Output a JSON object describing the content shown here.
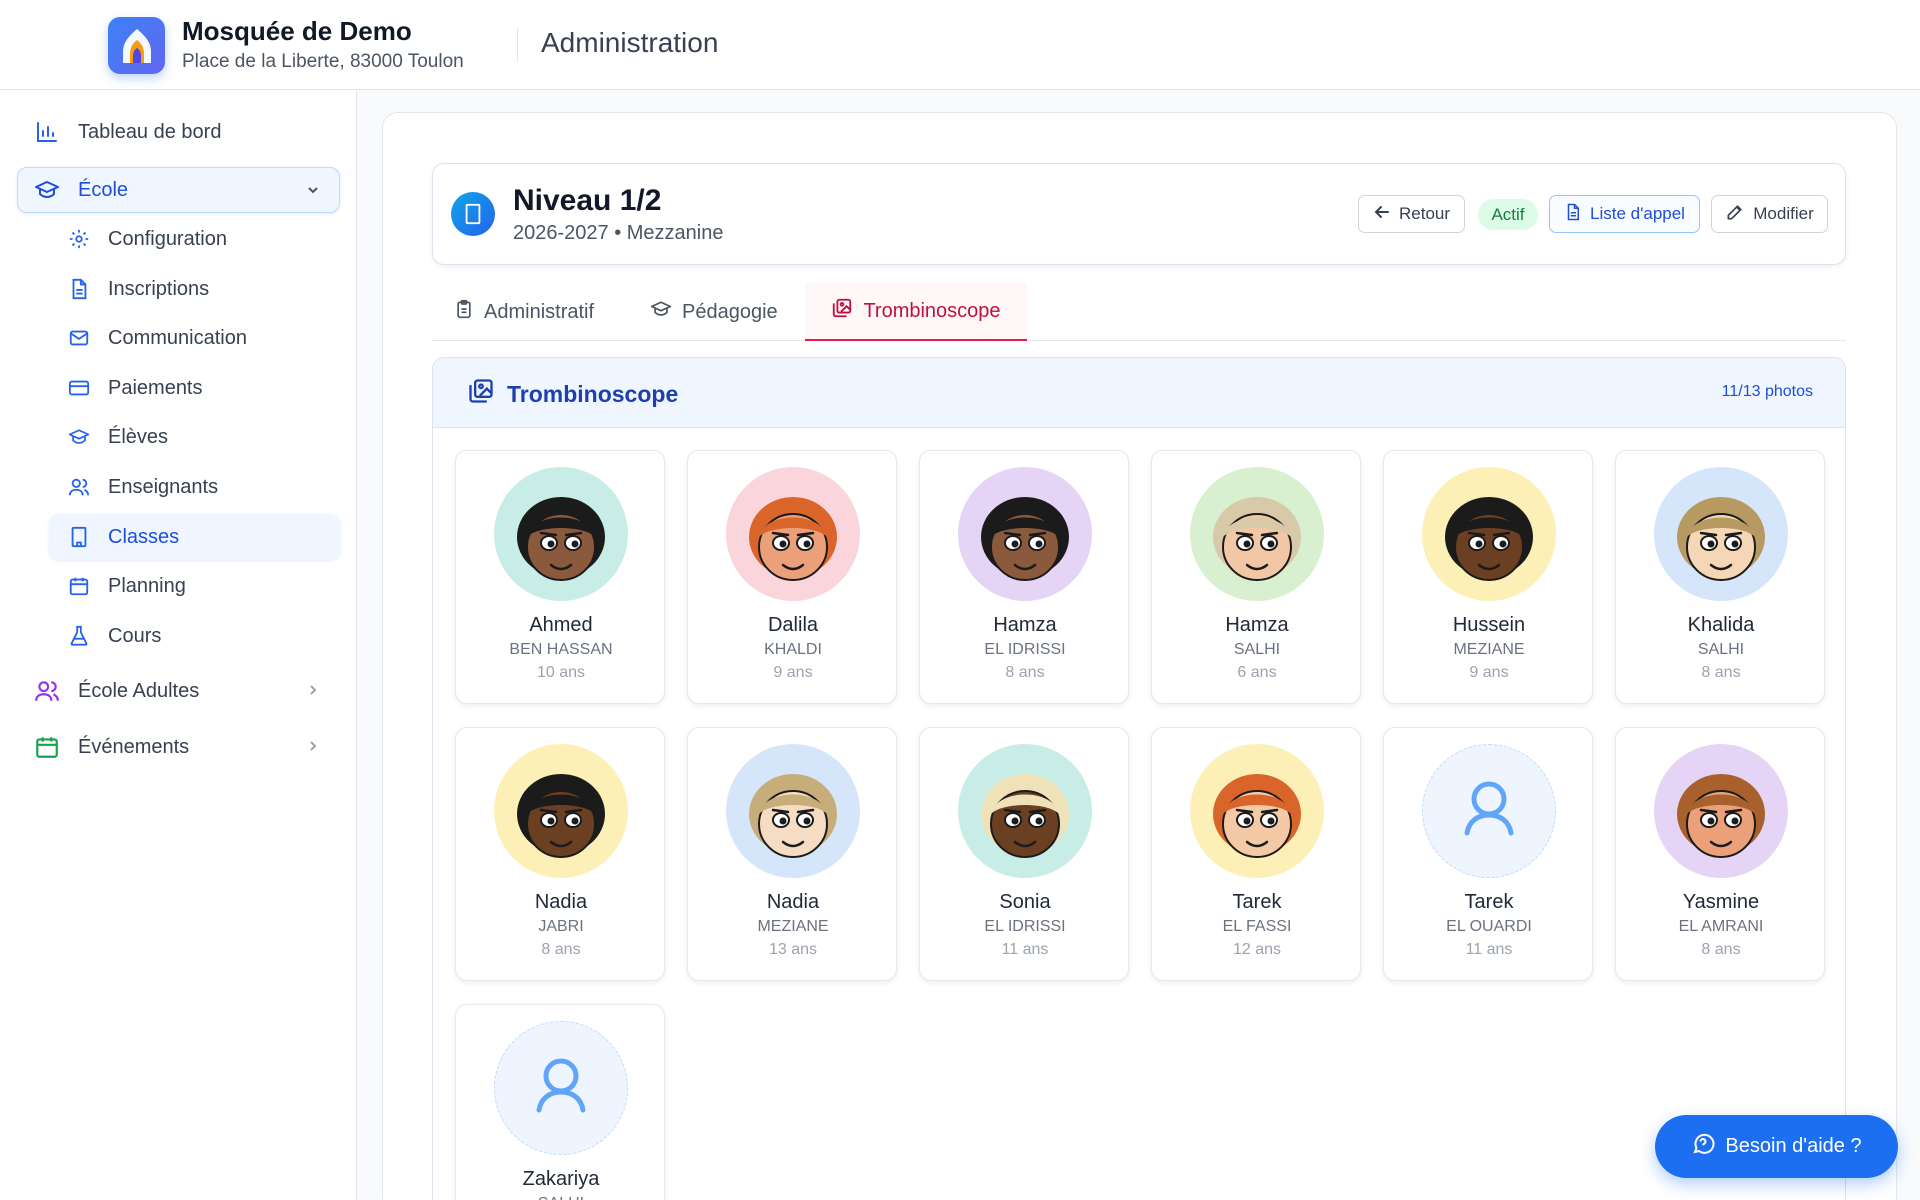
{
  "header": {
    "org_name": "Mosquée de Demo",
    "org_address": "Place de la Liberte, 83000 Toulon",
    "section": "Administration"
  },
  "sidebar": {
    "dashboard": "Tableau de bord",
    "ecole": "École",
    "sub": {
      "configuration": "Configuration",
      "inscriptions": "Inscriptions",
      "communication": "Communication",
      "paiements": "Paiements",
      "eleves": "Élèves",
      "enseignants": "Enseignants",
      "classes": "Classes",
      "planning": "Planning",
      "cours": "Cours"
    },
    "ecole_adultes": "École Adultes",
    "evenements": "Événements"
  },
  "class_header": {
    "title": "Niveau 1/2",
    "subtitle": "2026-2027 • Mezzanine",
    "retour": "Retour",
    "status": "Actif",
    "liste_appel": "Liste d'appel",
    "modifier": "Modifier"
  },
  "tabs": {
    "administratif": "Administratif",
    "pedagogie": "Pédagogie",
    "trombinoscope": "Trombinoscope"
  },
  "trombi": {
    "title": "Trombinoscope",
    "count": "11/13 photos",
    "students": [
      {
        "first": "Ahmed",
        "last": "BEN HASSAN",
        "age": "10 ans",
        "bg": "#c7ede6",
        "skin": "#8b5a3c",
        "hair": "#1b1b1b"
      },
      {
        "first": "Dalila",
        "last": "KHALDI",
        "age": "9 ans",
        "bg": "#fbd5dc",
        "skin": "#eba07a",
        "hair": "#d9652b"
      },
      {
        "first": "Hamza",
        "last": "EL IDRISSI",
        "age": "8 ans",
        "bg": "#e5d4f6",
        "skin": "#8b5a3c",
        "hair": "#1b1b1b"
      },
      {
        "first": "Hamza",
        "last": "SALHI",
        "age": "6 ans",
        "bg": "#d8f0cf",
        "skin": "#f2c7a5",
        "hair": "#d8c9a8"
      },
      {
        "first": "Hussein",
        "last": "MEZIANE",
        "age": "9 ans",
        "bg": "#fdf0b6",
        "skin": "#6b3f22",
        "hair": "#1b1b1b"
      },
      {
        "first": "Khalida",
        "last": "SALHI",
        "age": "8 ans",
        "bg": "#d5e6fa",
        "skin": "#f5d7b8",
        "hair": "#b79a62"
      },
      {
        "first": "Nadia",
        "last": "JABRI",
        "age": "8 ans",
        "bg": "#fdf0b6",
        "skin": "#6b3f22",
        "hair": "#1b1b1b"
      },
      {
        "first": "Nadia",
        "last": "MEZIANE",
        "age": "13 ans",
        "bg": "#d5e6fa",
        "skin": "#f5dcc3",
        "hair": "#c7ad7a"
      },
      {
        "first": "Sonia",
        "last": "EL IDRISSI",
        "age": "11 ans",
        "bg": "#c7ede6",
        "skin": "#6b3f22",
        "hair": "#efe1b8"
      },
      {
        "first": "Tarek",
        "last": "EL FASSI",
        "age": "12 ans",
        "bg": "#fdf0b6",
        "skin": "#f4c9a6",
        "hair": "#d9652b"
      },
      {
        "first": "Tarek",
        "last": "EL OUARDI",
        "age": "11 ans",
        "bg": "",
        "skin": "",
        "hair": ""
      },
      {
        "first": "Yasmine",
        "last": "EL AMRANI",
        "age": "8 ans",
        "bg": "#e5d4f6",
        "skin": "#eba07a",
        "hair": "#a8612c"
      },
      {
        "first": "Zakariya",
        "last": "SALHI",
        "age": "",
        "bg": "",
        "skin": "",
        "hair": ""
      }
    ]
  },
  "help": {
    "label": "Besoin d'aide ?"
  }
}
